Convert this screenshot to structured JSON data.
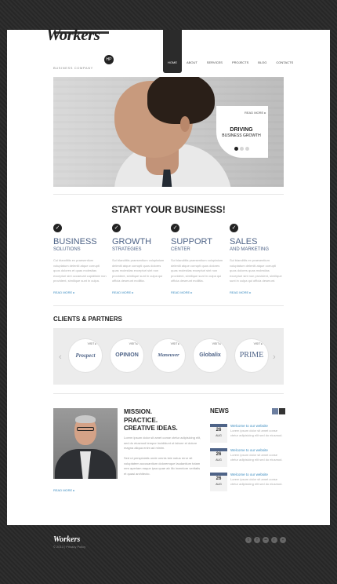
{
  "brand": {
    "logo": "Workers",
    "badge": "HP",
    "tagline": "BUSINESS COMPANY"
  },
  "nav": {
    "items": [
      {
        "label": "Home",
        "active": true
      },
      {
        "label": "About"
      },
      {
        "label": "Services"
      },
      {
        "label": "Projects"
      },
      {
        "label": "Blog"
      },
      {
        "label": "Contacts"
      }
    ]
  },
  "hero": {
    "link": "READ MORE ▸",
    "title": "DRIVING",
    "subtitle": "BUSINESS GROWTH",
    "slides": 3,
    "active_slide": 1
  },
  "features_heading": "START YOUR BUSINESS!",
  "features": [
    {
      "title": "BUSINESS",
      "subtitle": "SOLUTIONS",
      "text": "Cui blanditiis ex praesentium voluptatum deleniti atque corrupti quos dolores et quas molestias excepturi sint occaecati cupiditate non provident, similique sunt in culpa.",
      "more": "READ MORE ▸"
    },
    {
      "title": "GROWTH",
      "subtitle": "STRATEGIES",
      "text": "Sui blanditiis praesentium voluptatum deleniti atque corrupti quos dolores quas molestias excepturi sint non provident, similique sunt in culpa qui officia deserunt mollitia.",
      "more": "READ MORE ▸"
    },
    {
      "title": "SUPPORT",
      "subtitle": "CENTER",
      "text": "Sui blanditiis praesentium voluptatum deleniti atque corrupti quos dolores quas molestias excepturi sint non provident, similique sunt in culpa qui officia deserunt mollitia.",
      "more": "READ MORE ▸"
    },
    {
      "title": "SALES",
      "subtitle": "AND MARKETING",
      "text": "Sui blanditiis ex praesentium voluptatum deleniti atque corrupti quos dolores quas molestias excepturi sint non provident, similique sunt in culpa qui officia deserunt.",
      "more": "READ MORE ▸"
    }
  ],
  "clients_heading": "CLIENTS & PARTNERS",
  "clients": [
    {
      "name": "Prospect",
      "visit": "VISIT ▸"
    },
    {
      "name": "OPINION",
      "visit": "VISIT ▸"
    },
    {
      "name": "Maneuver",
      "visit": "VISIT ▸"
    },
    {
      "name": "Globalix",
      "visit": "VISIT ▸"
    },
    {
      "name": "PRIME",
      "visit": "VISIT ▸"
    }
  ],
  "mission": {
    "line1": "MISSION.",
    "line2": "PRACTICE.",
    "line3": "CREATIVE IDEAS.",
    "para1": "Lorem ipsum dolor sit amet conse ctetur adipisicing elit, sed do eiusmod tempor incididunt ut labore et dolore magna aliqua enim ad minim.",
    "para2": "Sed ut perspiciatis unde omnis iste natus error sit voluptatem accusantium doloremque laudantium totam rem aperiam eaque ipsa quae ab illo inventore veritatis et quasi architecto.",
    "more": "READ MORE ▸"
  },
  "news": {
    "heading": "NEWS",
    "items": [
      {
        "day": "26",
        "month": "AUG",
        "title": "Welcome to our website",
        "text": "Lorem ipsum dolor sit amet conse ctetur adipisicing elit sed do eiusmod."
      },
      {
        "day": "26",
        "month": "AUG",
        "title": "Welcome to our website",
        "text": "Lorem ipsum dolor sit amet conse ctetur adipisicing elit sed do eiusmod."
      },
      {
        "day": "26",
        "month": "AUG",
        "title": "Welcome to our website",
        "text": "Lorem ipsum dolor sit amet conse ctetur adipisicing elit sed do eiusmod."
      }
    ]
  },
  "footer": {
    "logo": "Workers",
    "copy": "© 2013 | Privacy Policy"
  },
  "social": [
    {
      "name": "twitter-icon",
      "glyph": "t"
    },
    {
      "name": "facebook-icon",
      "glyph": "f"
    },
    {
      "name": "flickr-icon",
      "glyph": "••"
    },
    {
      "name": "rss-icon",
      "glyph": "r"
    },
    {
      "name": "google-plus-icon",
      "glyph": "+"
    }
  ],
  "colors": {
    "accent": "#4e6387",
    "link": "#3a8bbf",
    "dark": "#2b2b2b"
  }
}
